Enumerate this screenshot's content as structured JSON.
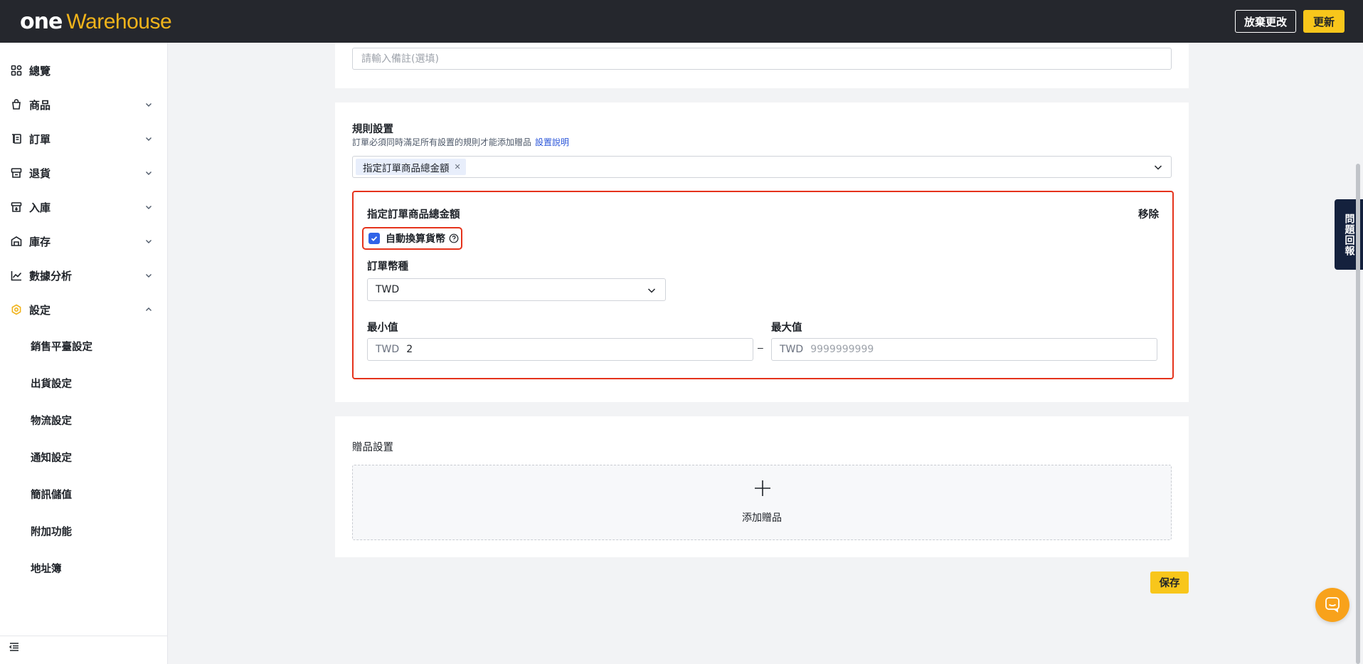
{
  "brand": {
    "logo_one": "one",
    "logo_warehouse": "Warehouse",
    "accent": "#f8c61b",
    "dark": "#25272d"
  },
  "header": {
    "discard_label": "放棄更改",
    "update_label": "更新"
  },
  "sidebar": {
    "items": [
      {
        "label": "總覽",
        "icon": "dashboard-icon"
      },
      {
        "label": "商品",
        "icon": "bag-icon"
      },
      {
        "label": "訂單",
        "icon": "receipt-icon"
      },
      {
        "label": "退貨",
        "icon": "return-icon"
      },
      {
        "label": "入庫",
        "icon": "inbound-icon"
      },
      {
        "label": "庫存",
        "icon": "warehouse-icon"
      },
      {
        "label": "數據分析",
        "icon": "chart-icon"
      },
      {
        "label": "設定",
        "icon": "settings-icon"
      }
    ],
    "sub_items": [
      "銷售平臺設定",
      "出貨設定",
      "物流設定",
      "通知設定",
      "簡訊儲值",
      "附加功能",
      "地址簿"
    ]
  },
  "remark": {
    "placeholder": "請輸入備註(選填)"
  },
  "rules": {
    "title": "規則設置",
    "description": "訂單必須同時滿足所有設置的規則才能添加贈品",
    "help_link": "設置說明",
    "selected_tag": "指定訂單商品總金額",
    "rule_title": "指定訂單商品總金額",
    "remove_label": "移除",
    "auto_convert_label": "自動換算貨幣",
    "auto_convert_checked": true,
    "currency_label": "訂單幣種",
    "currency_value": "TWD",
    "min_label": "最小值",
    "min_prefix": "TWD",
    "min_value": "2",
    "range_separator": "–",
    "max_label": "最大值",
    "max_prefix": "TWD",
    "max_placeholder": "9999999999"
  },
  "gifts": {
    "title": "贈品設置",
    "add_label": "添加贈品"
  },
  "footer": {
    "save_label": "保存"
  },
  "feedback": {
    "label": "問題回報"
  }
}
